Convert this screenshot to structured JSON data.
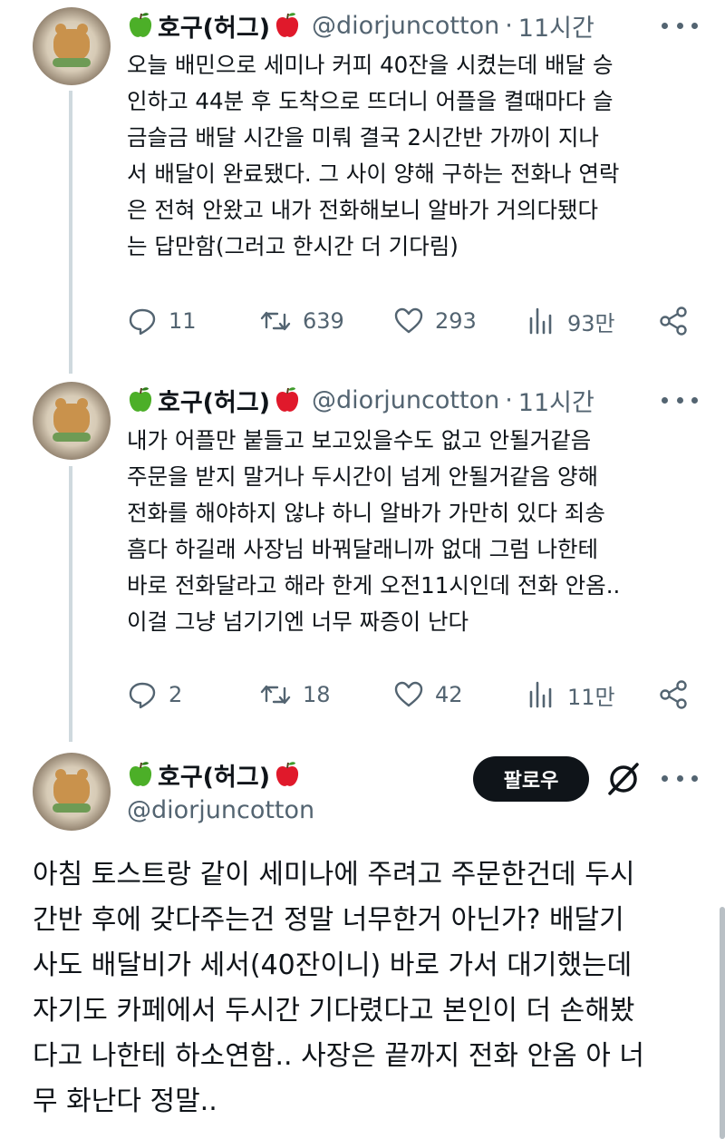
{
  "tweets": [
    {
      "author_name": "호구(허그)",
      "handle": "@diorjuncotton",
      "separator": "·",
      "time": "11시간",
      "text": "오늘 배민으로 세미나 커피 40잔을 시켰는데 배달 승\n인하고 44분 후 도착으로 뜨더니 어플을 켤때마다 슬\n금슬금 배달 시간을 미뤄 결국 2시간반 가까이 지나\n서 배달이 완료됐다. 그 사이 양해 구하는 전화나 연락\n은 전혀 안왔고 내가 전화해보니 알바가 거의다됐다\n는 답만함(그러고 한시간 더 기다림)",
      "replies": "11",
      "retweets": "639",
      "likes": "293",
      "views": "93만"
    },
    {
      "author_name": "호구(허그)",
      "handle": "@diorjuncotton",
      "separator": "·",
      "time": "11시간",
      "text": "내가 어플만 붙들고 보고있을수도 없고 안될거같음\n주문을 받지 말거나 두시간이 넘게 안될거같음 양해\n전화를 해야하지 않냐 하니 알바가 가만히 있다 죄송\n흠다 하길래 사장님 바꿔달래니까 없대 그럼 나한테\n바로 전화달라고 해라 한게 오전11시인데 전화 안옴..\n이걸 그냥 넘기기엔 너무 짜증이 난다",
      "replies": "2",
      "retweets": "18",
      "likes": "42",
      "views": "11만"
    }
  ],
  "main_tweet": {
    "author_name": "호구(허그)",
    "handle": "@diorjuncotton",
    "follow_label": "팔로우",
    "text": "아침 토스트랑 같이 세미나에 주려고 주문한건데 두시\n간반 후에 갖다주는건 정말 너무한거 아닌가? 배달기\n사도 배달비가 세서(40잔이니) 바로 가서 대기했는데\n자기도 카페에서 두시간 기다렸다고 본인이 더 손해봤\n다고 나한테 하소연함.. 사장은 끝까지 전화 안옴 아 너\n무 화난다 정말.."
  },
  "colors": {
    "text": "#0f1419",
    "secondary": "#536471",
    "green_apple": "#4caf28",
    "red_apple": "#e0192b",
    "thread_line": "#cfd9de"
  },
  "icons": [
    "green-apple-icon",
    "red-apple-icon",
    "more-icon",
    "reply-icon",
    "retweet-icon",
    "like-icon",
    "views-icon",
    "share-icon",
    "grok-icon"
  ]
}
